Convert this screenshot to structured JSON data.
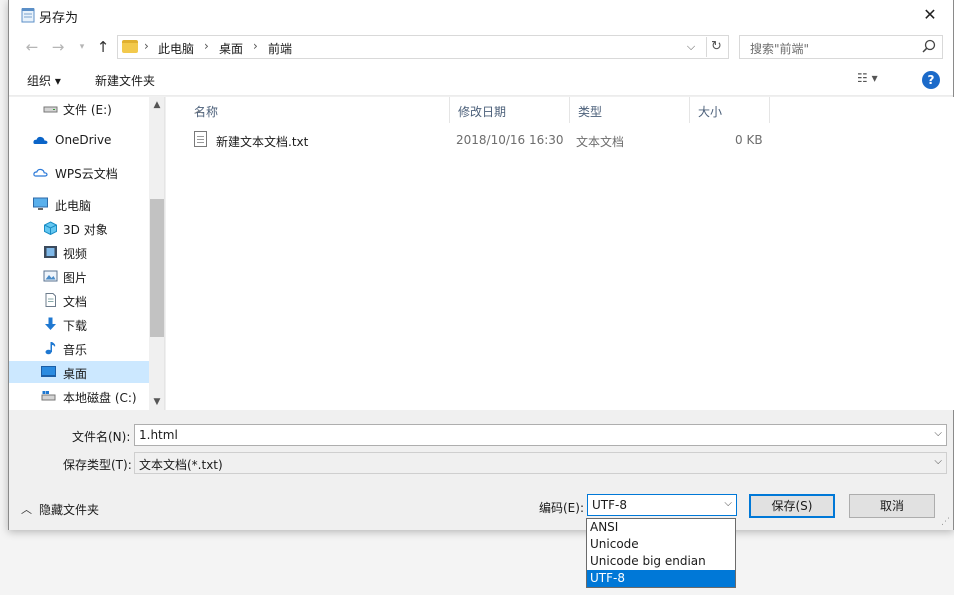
{
  "window": {
    "title": "另存为",
    "close_glyph": "✕"
  },
  "address": {
    "crumbs": [
      "此电脑",
      "桌面",
      "前端"
    ],
    "separator": "›",
    "search_placeholder": "搜索\"前端\""
  },
  "toolbar": {
    "organize_label": "组织 ▾",
    "new_folder_label": "新建文件夹",
    "view_glyph": "☷ ▾",
    "help_glyph": "?"
  },
  "nav": {
    "items": [
      {
        "label": "文件 (E:)",
        "icon": "drive-icon"
      },
      {
        "label": "OneDrive",
        "icon": "cloud-icon"
      },
      {
        "label": "WPS云文档",
        "icon": "cloud-outline-icon"
      },
      {
        "label": "此电脑",
        "icon": "computer-icon"
      },
      {
        "label": "3D 对象",
        "icon": "cube-icon"
      },
      {
        "label": "视频",
        "icon": "video-icon"
      },
      {
        "label": "图片",
        "icon": "picture-icon"
      },
      {
        "label": "文档",
        "icon": "document-icon"
      },
      {
        "label": "下载",
        "icon": "download-icon"
      },
      {
        "label": "音乐",
        "icon": "music-icon"
      },
      {
        "label": "桌面",
        "icon": "desktop-icon"
      },
      {
        "label": "本地磁盘 (C:)",
        "icon": "drive-c-icon"
      }
    ],
    "selected": "桌面"
  },
  "files": {
    "columns": [
      "名称",
      "修改日期",
      "类型",
      "大小"
    ],
    "rows": [
      {
        "name": "新建文本文档.txt",
        "date": "2018/10/16 16:30",
        "type": "文本文档",
        "size": "0 KB"
      }
    ]
  },
  "form": {
    "filename_label": "文件名(N):",
    "filename_value": "1.html",
    "filetype_label": "保存类型(T):",
    "filetype_value": "文本文档(*.txt)",
    "encoding_label": "编码(E):",
    "encoding_value": "UTF-8",
    "encoding_options": [
      "ANSI",
      "Unicode",
      "Unicode big endian",
      "UTF-8"
    ],
    "hide_folders_label": "隐藏文件夹",
    "save_label": "保存(S)",
    "cancel_label": "取消"
  },
  "colors": {
    "accent": "#0078d7",
    "selection": "#cce8ff"
  }
}
